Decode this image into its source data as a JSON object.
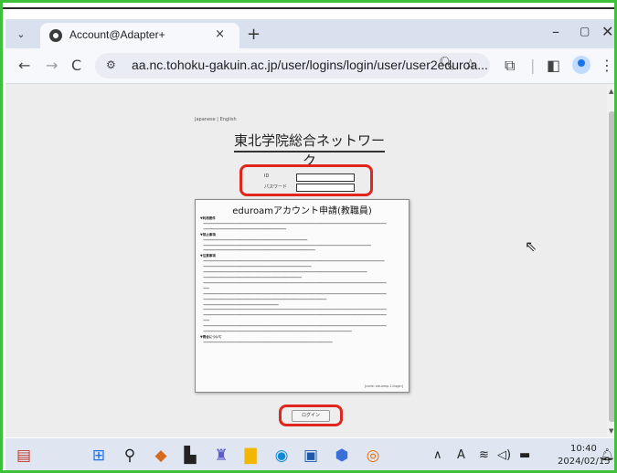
{
  "browser": {
    "tab_title": "Account@Adapter+",
    "tab_close": "×",
    "new_tab": "+",
    "tab_menu": "⌄",
    "url": "aa.nc.tohoku-gakuin.ac.jp/user/logins/login/user/user2eduroa...",
    "back": "←",
    "forward": "→",
    "reload": "C",
    "window_min": "–",
    "window_max": "▢",
    "window_close": "✕"
  },
  "page": {
    "lang_links": "Japanese | English",
    "site_title": "東北学院総合ネットワーク",
    "id_label": "ID",
    "pw_label": "パスワード",
    "dialog_title": "eduroamアカウント申請(教職員)",
    "dialog_code": "[code: eduamp-11login]",
    "login_button": "ログイン"
  },
  "taskbar": {
    "time": "10:40",
    "date": "2024/02/15",
    "lang_indicator": "A"
  },
  "colors": {
    "highlight_red": "#e0261e",
    "frame_green": "#3ec03a"
  }
}
